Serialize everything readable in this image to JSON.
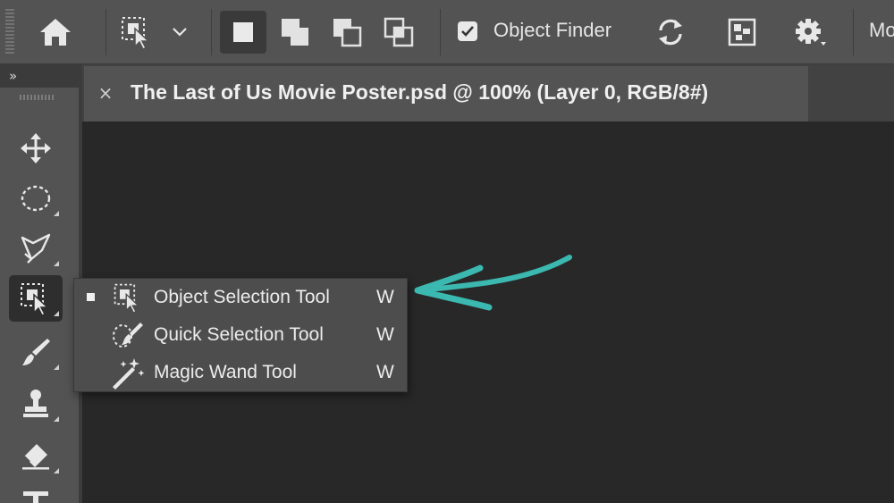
{
  "options_bar": {
    "icons": [
      "home-icon",
      "object-selection-icon",
      "chevron-down-icon",
      "new-selection-icon",
      "add-to-selection-icon",
      "subtract-from-selection-icon",
      "intersect-selection-icon",
      "checkbox-checked-icon",
      "refresh-icon",
      "show-all-objects-icon",
      "gear-icon"
    ],
    "object_finder_label": "Object Finder",
    "object_finder_checked": true,
    "mode_label_cut": "Mo"
  },
  "toolbar": {
    "collapse_label": "»",
    "tools": [
      "move-tool",
      "marquee-tool",
      "lasso-tool",
      "object-selection-tool",
      "brush-tool",
      "clone-stamp-tool",
      "eraser-tool",
      "type-tool"
    ],
    "active_tool": "object-selection-tool"
  },
  "document_tab": {
    "close_glyph": "×",
    "title": "The Last of Us Movie Poster.psd @ 100% (Layer 0, RGB/8#)"
  },
  "flyout_menu": {
    "items": [
      {
        "label": "Object Selection Tool",
        "shortcut": "W",
        "icon": "object-selection-icon",
        "selected": true
      },
      {
        "label": "Quick Selection Tool",
        "shortcut": "W",
        "icon": "quick-selection-icon",
        "selected": false
      },
      {
        "label": "Magic Wand Tool",
        "shortcut": "W",
        "icon": "magic-wand-icon",
        "selected": false
      }
    ]
  },
  "colors": {
    "panel": "#535353",
    "canvas": "#282828",
    "tab_strip": "#424242",
    "active_bg": "#3a3a3a",
    "menu_bg": "#4d4d4d",
    "annotation_arrow": "#3bb8b0",
    "text": "#ececec"
  }
}
